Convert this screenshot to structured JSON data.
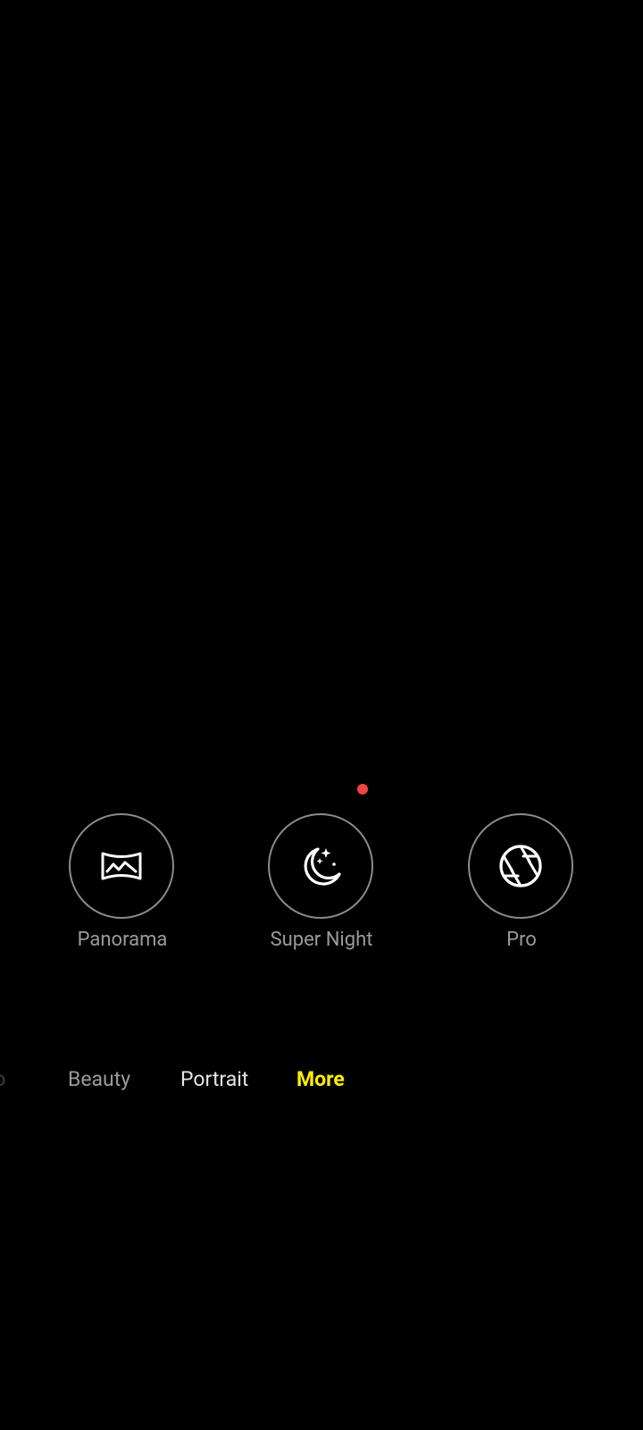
{
  "modes_grid": {
    "items": [
      {
        "label": "Panorama",
        "icon": "panorama-icon"
      },
      {
        "label": "Super Night",
        "icon": "moon-stars-icon",
        "new_indicator": true,
        "indicator_color": "#ee4444"
      },
      {
        "label": "Pro",
        "icon": "aperture-icon"
      }
    ]
  },
  "mode_bar": {
    "tabs": [
      {
        "label": "to",
        "state": "partially-visible"
      },
      {
        "label": "Beauty",
        "state": "inactive"
      },
      {
        "label": "Portrait",
        "state": "inactive"
      },
      {
        "label": "More",
        "state": "active"
      }
    ],
    "active_color": "#ffee00"
  }
}
